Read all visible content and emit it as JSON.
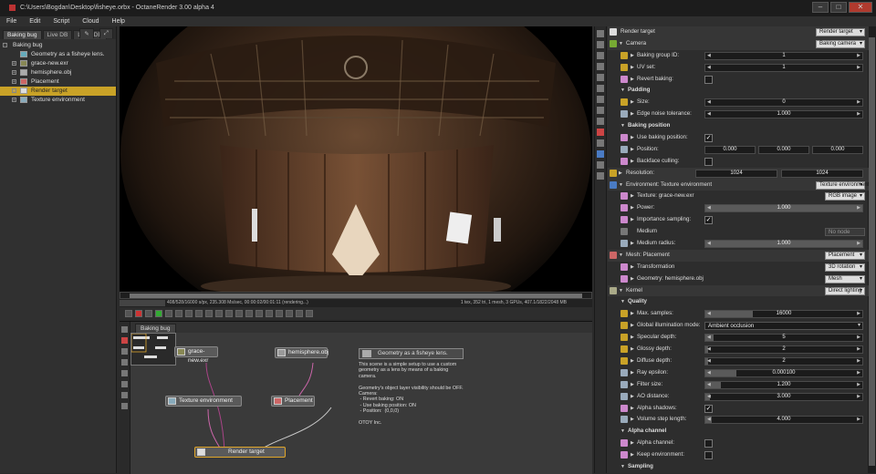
{
  "window": {
    "title": "C:\\Users\\Bogdan\\Desktop\\fisheye.orbx - OctaneRender 3.00 alpha 4",
    "min": "‒",
    "max": "□",
    "close": "✕"
  },
  "menu": [
    "File",
    "Edit",
    "Script",
    "Cloud",
    "Help"
  ],
  "left_panel": {
    "tabs": [
      "Baking bug",
      "Live DB",
      "Local DB"
    ],
    "tree_root": "Baking bug",
    "items": [
      "Geometry as a fisheye lens.",
      "grace-new.exr",
      "hemisphere.obj",
      "Placement",
      "Render target",
      "Texture environment"
    ],
    "selected_item": "Render target"
  },
  "viewport": {
    "status_left": "408/528/16000 s/px, 235.308 Ms/sec, 00:00:02/00:01:11 (rendering...)",
    "status_right": "1 tex, 352 tri, 1 mesh, 3 GPUs, 407.1/1822/2048 MB"
  },
  "node_graph": {
    "tab": "Baking bug",
    "nodes": {
      "grace": "grace-new.exr",
      "hemisphere": "hemisphere.obj",
      "texenv": "Texture environment",
      "placement": "Placement",
      "rendertarget": "Render target"
    },
    "comment": {
      "title": "Geometry as a fisheye lens.",
      "body": "This scene is a simple setup to use a custom geometry as a lens by means of a baking camera.\n\nGeometry's object layer visibility should be OFF.\nCamera:\n - Revert baking: ON\n - Use baking position: ON\n - Position:  (0,0,0)\n\nOTOY Inc."
    }
  },
  "inspector": {
    "header": {
      "label": "Render target",
      "value": "Render target"
    },
    "camera": {
      "label": "Camera",
      "value": "Baking camera"
    },
    "baking_group_id": {
      "label": "Baking group ID:",
      "value": "1"
    },
    "uv_set": {
      "label": "UV set:",
      "value": "1"
    },
    "revert_baking": {
      "label": "Revert baking:"
    },
    "padding": "Padding",
    "size": {
      "label": "Size:",
      "value": "0"
    },
    "edge_noise": {
      "label": "Edge noise tolerance:",
      "value": "1.000"
    },
    "baking_position": "Baking position",
    "use_baking_position": {
      "label": "Use baking position:",
      "checked": "✓"
    },
    "position": {
      "label": "Position:",
      "x": "0.000",
      "y": "0.000",
      "z": "0.000"
    },
    "backface_culling": {
      "label": "Backface culling:"
    },
    "resolution": {
      "label": "Resolution:",
      "w": "1024",
      "h": "1024"
    },
    "environment": {
      "label": "Environment: Texture environment",
      "value": "Texture environment"
    },
    "texture": {
      "label": "Texture: grace-new.exr",
      "value": "RGB image"
    },
    "power": {
      "label": "Power:",
      "value": "1.000"
    },
    "importance_sampling": {
      "label": "Importance sampling:",
      "checked": "✓"
    },
    "medium": {
      "label": "Medium",
      "value": "No node"
    },
    "medium_radius": {
      "label": "Medium radius:",
      "value": "1.000"
    },
    "mesh": {
      "label": "Mesh: Placement",
      "value": "Placement"
    },
    "transformation": {
      "label": "Transformation",
      "value": "3D rotation"
    },
    "geometry": {
      "label": "Geometry: hemisphere.obj",
      "value": "Mesh"
    },
    "kernel": {
      "label": "Kernel",
      "value": "Direct lighting"
    },
    "quality": "Quality",
    "max_samples": {
      "label": "Max. samples:",
      "value": "16000"
    },
    "gi_mode": {
      "label": "Global illumination mode:",
      "value": "Ambient occlusion"
    },
    "specular_depth": {
      "label": "Specular depth:",
      "value": "5"
    },
    "glossy_depth": {
      "label": "Glossy depth:",
      "value": "2"
    },
    "diffuse_depth": {
      "label": "Diffuse depth:",
      "value": "2"
    },
    "ray_epsilon": {
      "label": "Ray epsilon:",
      "value": "0.000100"
    },
    "filter_size": {
      "label": "Filter size:",
      "value": "1.200"
    },
    "ao_distance": {
      "label": "AO distance:",
      "value": "3.000"
    },
    "alpha_shadows": {
      "label": "Alpha shadows:",
      "checked": "✓"
    },
    "volume_step": {
      "label": "Volume step length:",
      "value": "4.000"
    },
    "alpha_channel_grp": "Alpha channel",
    "alpha_channel": {
      "label": "Alpha channel:"
    },
    "keep_environment": {
      "label": "Keep environment:"
    },
    "sampling": "Sampling"
  },
  "colors": {
    "accent": "#c9a227",
    "selection": "#e0a52a",
    "close": "#b03a2e"
  }
}
